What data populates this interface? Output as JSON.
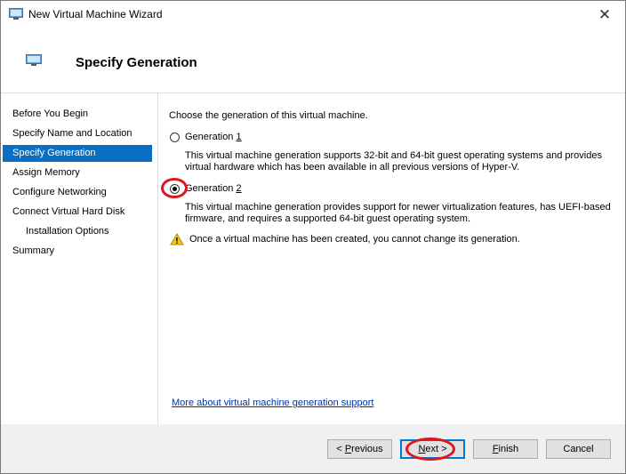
{
  "window": {
    "title": "New Virtual Machine Wizard",
    "close_glyph": "✕"
  },
  "header": {
    "title": "Specify Generation"
  },
  "sidebar": {
    "items": [
      {
        "label": "Before You Begin"
      },
      {
        "label": "Specify Name and Location"
      },
      {
        "label": "Specify Generation"
      },
      {
        "label": "Assign Memory"
      },
      {
        "label": "Configure Networking"
      },
      {
        "label": "Connect Virtual Hard Disk"
      },
      {
        "label": "Installation Options"
      },
      {
        "label": "Summary"
      }
    ]
  },
  "content": {
    "prompt": "Choose the generation of this virtual machine.",
    "gen1": {
      "label_prefix": "Generation ",
      "label_key": "1",
      "desc": "This virtual machine generation supports 32-bit and 64-bit guest operating systems and provides virtual hardware which has been available in all previous versions of Hyper-V."
    },
    "gen2": {
      "label_prefix": "Generation ",
      "label_key": "2",
      "desc": "This virtual machine generation provides support for newer virtualization features, has UEFI-based firmware, and requires a supported 64-bit guest operating system."
    },
    "warning": "Once a virtual machine has been created, you cannot change its generation.",
    "link": "More about virtual machine generation support"
  },
  "footer": {
    "previous": {
      "prefix": "< ",
      "key": "P",
      "rest": "revious"
    },
    "next": {
      "key": "N",
      "rest": "ext >"
    },
    "finish": {
      "key": "F",
      "rest": "inish"
    },
    "cancel": "Cancel"
  },
  "colors": {
    "accent": "#0a6fc2",
    "annotation": "#e0141b",
    "link": "#0033aa"
  }
}
